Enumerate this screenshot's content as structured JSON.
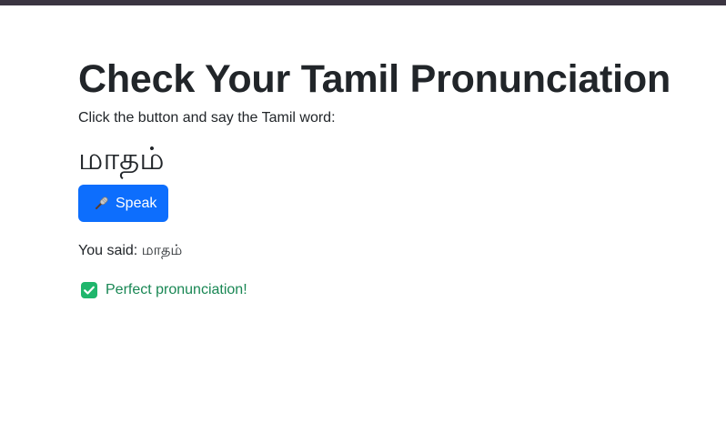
{
  "page": {
    "title": "Check Your Tamil Pronunciation",
    "instruction": "Click the button and say the Tamil word:",
    "target_word": "மாதம்",
    "speak_button": {
      "icon": "microphone-icon",
      "label": "Speak"
    },
    "result": {
      "prefix": "You said:",
      "heard_word": "மாதம்"
    },
    "feedback": {
      "icon": "check-mark-icon",
      "text": "Perfect pronunciation!"
    }
  },
  "colors": {
    "top_bar": "#3b3541",
    "button": "#0d6efd",
    "success_text": "#198754",
    "success_icon": "#1fb66c"
  }
}
